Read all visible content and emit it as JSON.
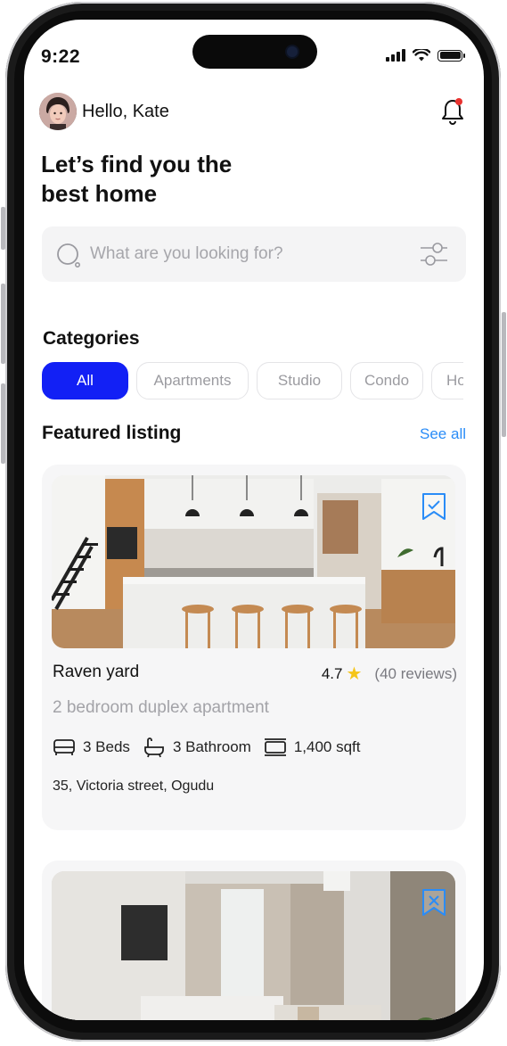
{
  "status_bar": {
    "time": "9:22"
  },
  "header": {
    "greeting": "Hello, Kate",
    "headline_line1": "Let’s find you the",
    "headline_line2": "best home"
  },
  "search": {
    "placeholder": "What are you looking for?"
  },
  "categories": {
    "title": "Categories",
    "items": [
      {
        "label": "All",
        "active": true
      },
      {
        "label": "Apartments",
        "active": false
      },
      {
        "label": "Studio",
        "active": false
      },
      {
        "label": "Condo",
        "active": false
      },
      {
        "label": "House",
        "active": false
      }
    ]
  },
  "featured": {
    "title": "Featured listing",
    "see_all": "See all"
  },
  "listings": [
    {
      "name": "Raven yard",
      "rating": "4.7",
      "reviews": "(40 reviews)",
      "description": "2 bedroom duplex apartment",
      "beds": "3 Beds",
      "baths": "3 Bathroom",
      "area": "1,400 sqft",
      "address": "35, Victoria street, Ogudu"
    }
  ],
  "colors": {
    "accent": "#1220f5",
    "link": "#2a8cf7",
    "star": "#f5c518"
  }
}
